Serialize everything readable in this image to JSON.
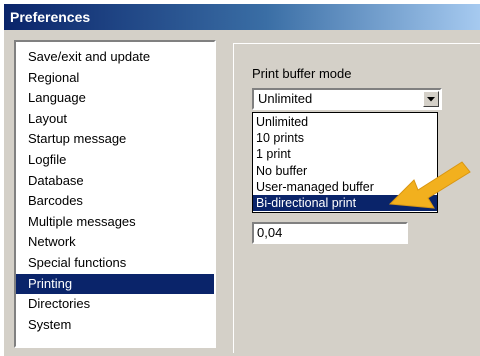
{
  "window": {
    "title": "Preferences"
  },
  "categories": {
    "items": [
      "Save/exit and update",
      "Regional",
      "Language",
      "Layout",
      "Startup message",
      "Logfile",
      "Database",
      "Barcodes",
      "Multiple messages",
      "Network",
      "Special functions",
      "Printing",
      "Directories",
      "System"
    ],
    "selected": "Printing"
  },
  "printing": {
    "buffer_mode_label": "Print buffer mode",
    "buffer_mode_value": "Unlimited",
    "options": [
      "Unlimited",
      "10 prints",
      "1 print",
      "No buffer",
      "User-managed buffer",
      "Bi-directional print"
    ],
    "highlighted_option": "Bi-directional print",
    "numeric_value": "0,04"
  },
  "colors": {
    "selection": "#0a246a",
    "face": "#d4d0c8",
    "callout_arrow": "#f2b01e"
  },
  "icons": {
    "dropdown_button": "chevron-down-icon",
    "callout": "arrow-pointer-icon"
  }
}
